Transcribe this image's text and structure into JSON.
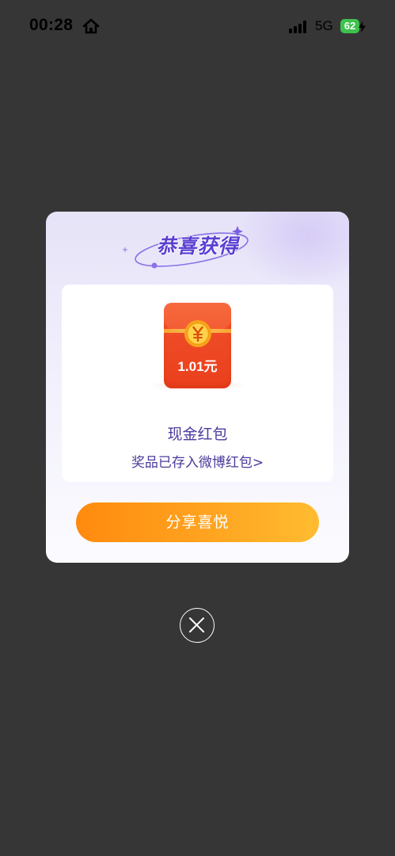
{
  "status_bar": {
    "time": "00:28",
    "network": "5G",
    "battery": "62"
  },
  "modal": {
    "title": "恭喜获得",
    "prize": {
      "envelope_amount": "1.01元",
      "name": "现金红包",
      "link_text": "奖品已存入微博红包>"
    },
    "share_button_label": "分享喜悦"
  },
  "icons": {
    "home": "home-icon",
    "signal": "cellular-signal-icon",
    "charging": "charging-bolt-icon",
    "coin": "yuan-coin-icon",
    "close": "close-icon"
  },
  "colors": {
    "overlay": "#363636",
    "title": "#5b3fd2",
    "prize_text": "#4b3b9c",
    "envelope": "#ea3f1c",
    "button_start": "#ff8a0e",
    "button_end": "#ffbc30"
  }
}
